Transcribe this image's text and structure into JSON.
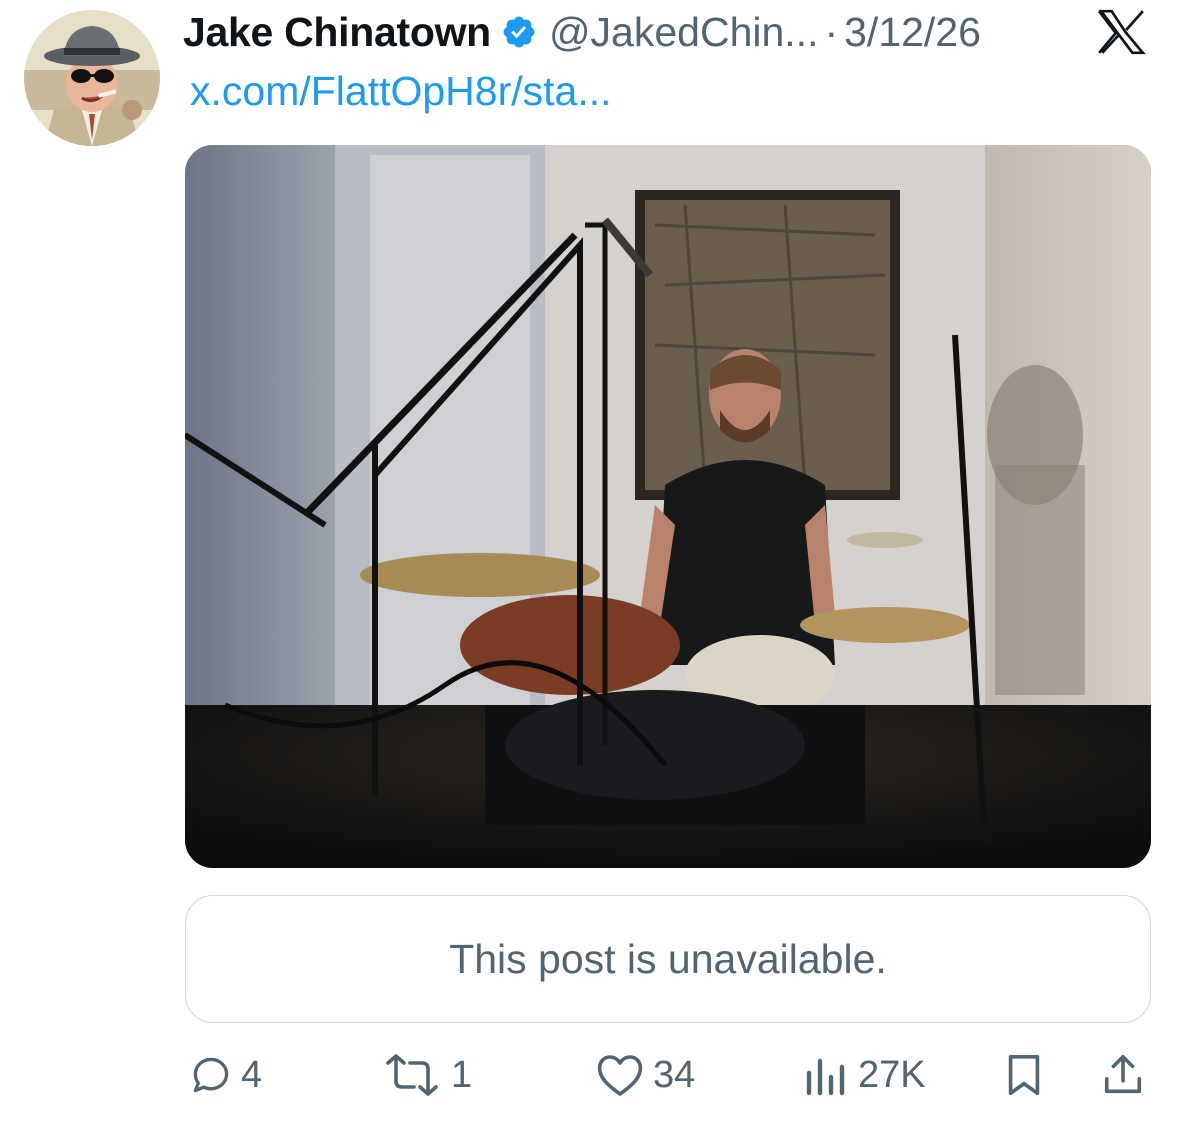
{
  "post": {
    "author_name": "Jake Chinatown",
    "handle": "@JakedChin...",
    "separator": "·",
    "date": "3/12/26",
    "link": "x.com/FlattOpH8r/sta...",
    "verified": true,
    "media_alt": "Drummer seated behind a drum kit with microphones and cymbals in a small room"
  },
  "quoted_post": {
    "message": "This post is unavailable."
  },
  "actions": {
    "replies": "4",
    "reposts": "1",
    "likes": "34",
    "views": "27K"
  },
  "icons": {
    "avatar": "cartoon-detective-avatar",
    "verified": "verified-badge-icon",
    "platform": "x-logo-icon",
    "reply": "reply-icon",
    "repost": "repost-icon",
    "like": "heart-icon",
    "views": "views-icon",
    "bookmark": "bookmark-icon",
    "share": "share-icon"
  },
  "colors": {
    "link": "#1d9bf0",
    "secondary_text": "#536471",
    "verified": "#1d9bf0",
    "border": "#cfd9de"
  }
}
